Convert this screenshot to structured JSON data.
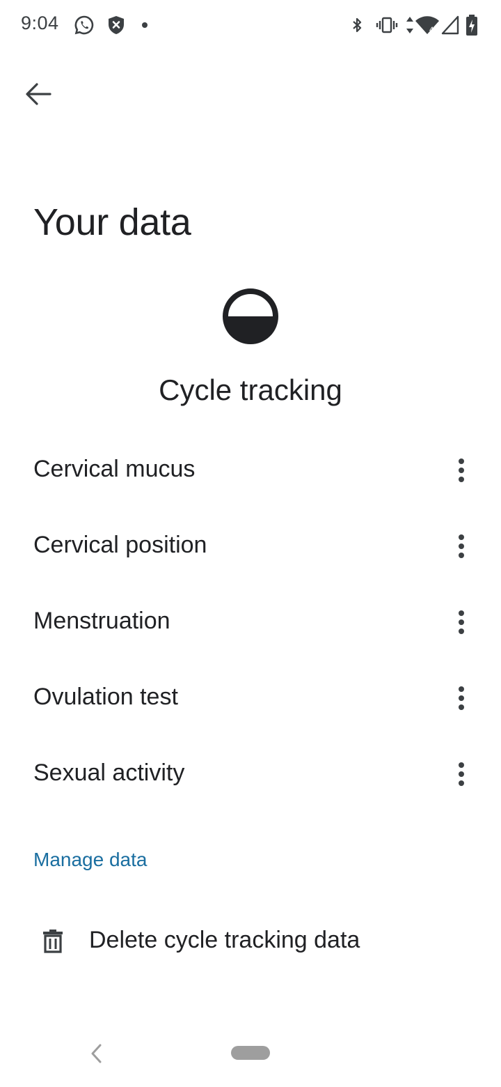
{
  "status_bar": {
    "time": "9:04",
    "left_icons": [
      "whatsapp-icon",
      "shield-x-icon",
      "dot-icon"
    ],
    "right_icons": [
      "bluetooth-icon",
      "vibrate-icon",
      "data-arrows-icon",
      "wifi-icon",
      "signal-icon",
      "battery-charging-icon"
    ]
  },
  "header": {
    "back_icon": "arrow-back-icon",
    "title": "Your data"
  },
  "section": {
    "icon": "cycle-tracking-icon",
    "title": "Cycle tracking"
  },
  "data_types": [
    {
      "label": "Cervical mucus",
      "menu_icon": "more-vert-icon"
    },
    {
      "label": "Cervical position",
      "menu_icon": "more-vert-icon"
    },
    {
      "label": "Menstruation",
      "menu_icon": "more-vert-icon"
    },
    {
      "label": "Ovulation test",
      "menu_icon": "more-vert-icon"
    },
    {
      "label": "Sexual activity",
      "menu_icon": "more-vert-icon"
    }
  ],
  "manage": {
    "header": "Manage data",
    "delete_label": "Delete cycle tracking data",
    "delete_icon": "trash-icon"
  },
  "colors": {
    "accent": "#1a6ea0",
    "text": "#202124",
    "icon": "#3c4043",
    "nav_pill": "#9e9e9e"
  },
  "nav_bar": {
    "back_icon": "nav-back-icon",
    "home_icon": "home-pill-icon"
  }
}
